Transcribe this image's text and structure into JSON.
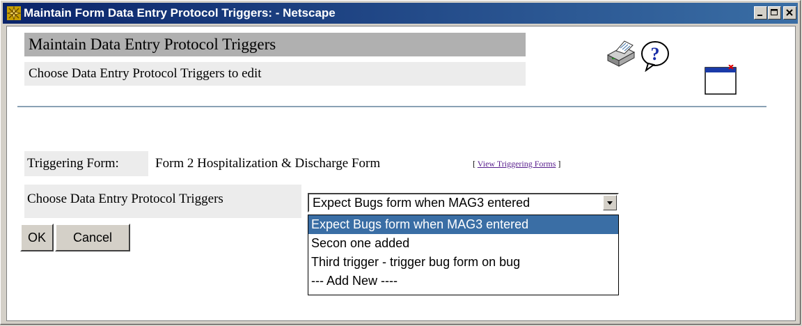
{
  "window": {
    "title": "Maintain Form Data Entry Protocol Triggers: - Netscape",
    "app_icon": "netscape-icon",
    "controls": [
      "minimize-icon",
      "maximize-icon",
      "close-icon"
    ]
  },
  "header": {
    "title": "Maintain Data Entry Protocol Triggers",
    "subtitle": "Choose Data Entry Protocol Triggers to edit",
    "icons": [
      "printer-icon",
      "help-icon",
      "close-window-icon"
    ]
  },
  "triggering_form": {
    "label": "Triggering Form:",
    "value": "Form 2 Hospitalization & Discharge Form",
    "link_open": "[",
    "link_text": "View Triggering Forms",
    "link_close": "]"
  },
  "trigger_select": {
    "label": "Choose Data Entry Protocol Triggers",
    "selected": "Expect Bugs form when MAG3 entered",
    "options": [
      "Expect Bugs form when MAG3 entered",
      "Secon one added",
      "Third trigger - trigger bug form on bug",
      "--- Add New ----"
    ]
  },
  "buttons": {
    "ok": "OK",
    "cancel": "Cancel"
  },
  "colors": {
    "title_bar": "#0a246a",
    "selection": "#3a6ea5",
    "link": "#551a8b",
    "rule": "#8aa1b4"
  }
}
